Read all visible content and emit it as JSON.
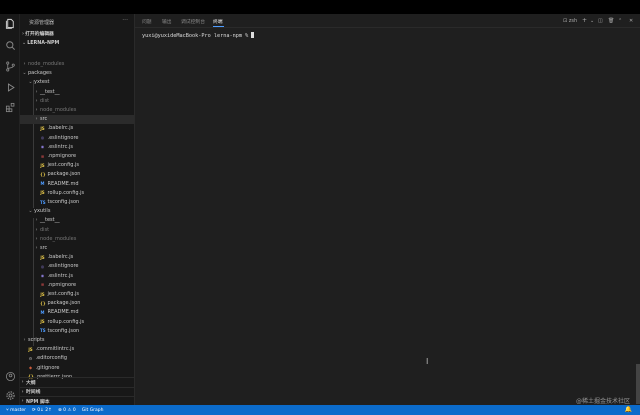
{
  "sidebar": {
    "title": "资源管理器",
    "open_editors": "打开的编辑器",
    "project": "LERNA-NPM",
    "rows": [
      {
        "label": "node_modules",
        "depth": 1,
        "chev": "›",
        "icon": "",
        "dim": true
      },
      {
        "label": "packages",
        "depth": 1,
        "chev": "⌄",
        "icon": "",
        "dim": false
      },
      {
        "label": "yxtest",
        "depth": 2,
        "chev": "⌄",
        "icon": "",
        "dim": false
      },
      {
        "label": "__test__",
        "depth": 3,
        "chev": "›",
        "icon": "",
        "dim": false
      },
      {
        "label": "dist",
        "depth": 3,
        "chev": "›",
        "icon": "",
        "dim": true
      },
      {
        "label": "node_modules",
        "depth": 3,
        "chev": "›",
        "icon": "",
        "dim": true
      },
      {
        "label": "src",
        "depth": 3,
        "chev": "›",
        "icon": "",
        "dim": false,
        "selected": true
      },
      {
        "label": ".babelrc.js",
        "depth": 3,
        "chev": "",
        "icon": "JS",
        "color": "#e8c94a"
      },
      {
        "label": ".eslintignore",
        "depth": 3,
        "chev": "",
        "icon": "◎",
        "color": "#8a7bd6"
      },
      {
        "label": ".eslintrc.js",
        "depth": 3,
        "chev": "",
        "icon": "◉",
        "color": "#8a7bd6"
      },
      {
        "label": ".npmignore",
        "depth": 3,
        "chev": "",
        "icon": "≡",
        "color": "#cc4b4b"
      },
      {
        "label": "jest.config.js",
        "depth": 3,
        "chev": "",
        "icon": "JS",
        "color": "#e8c94a"
      },
      {
        "label": "package.json",
        "depth": 3,
        "chev": "",
        "icon": "{}",
        "color": "#e8c94a"
      },
      {
        "label": "README.md",
        "depth": 3,
        "chev": "",
        "icon": "M",
        "color": "#4e9cff"
      },
      {
        "label": "rollup.config.js",
        "depth": 3,
        "chev": "",
        "icon": "JS",
        "color": "#e8c94a"
      },
      {
        "label": "tsconfig.json",
        "depth": 3,
        "chev": "",
        "icon": "TS",
        "color": "#4e9cff"
      },
      {
        "label": "yxutils",
        "depth": 2,
        "chev": "⌄",
        "icon": "",
        "dim": false
      },
      {
        "label": "__test__",
        "depth": 3,
        "chev": "›",
        "icon": "",
        "dim": false
      },
      {
        "label": "dist",
        "depth": 3,
        "chev": "›",
        "icon": "",
        "dim": true
      },
      {
        "label": "node_modules",
        "depth": 3,
        "chev": "›",
        "icon": "",
        "dim": true
      },
      {
        "label": "src",
        "depth": 3,
        "chev": "›",
        "icon": "",
        "dim": false
      },
      {
        "label": ".babelrc.js",
        "depth": 3,
        "chev": "",
        "icon": "JS",
        "color": "#e8c94a"
      },
      {
        "label": ".eslintignore",
        "depth": 3,
        "chev": "",
        "icon": "◎",
        "color": "#8a7bd6"
      },
      {
        "label": ".eslintrc.js",
        "depth": 3,
        "chev": "",
        "icon": "◉",
        "color": "#8a7bd6"
      },
      {
        "label": ".npmignore",
        "depth": 3,
        "chev": "",
        "icon": "≡",
        "color": "#cc4b4b"
      },
      {
        "label": "jest.config.js",
        "depth": 3,
        "chev": "",
        "icon": "JS",
        "color": "#e8c94a"
      },
      {
        "label": "package.json",
        "depth": 3,
        "chev": "",
        "icon": "{}",
        "color": "#e8c94a"
      },
      {
        "label": "README.md",
        "depth": 3,
        "chev": "",
        "icon": "M",
        "color": "#4e9cff"
      },
      {
        "label": "rollup.config.js",
        "depth": 3,
        "chev": "",
        "icon": "JS",
        "color": "#e8c94a"
      },
      {
        "label": "tsconfig.json",
        "depth": 3,
        "chev": "",
        "icon": "TS",
        "color": "#4e9cff"
      },
      {
        "label": "scripts",
        "depth": 1,
        "chev": "›",
        "icon": "",
        "dim": false
      },
      {
        "label": ".commitlintrc.js",
        "depth": 1,
        "chev": "",
        "icon": "JS",
        "color": "#e8c94a"
      },
      {
        "label": ".editorconfig",
        "depth": 1,
        "chev": "",
        "icon": "⚙",
        "color": "#aaaaaa"
      },
      {
        "label": ".gitignore",
        "depth": 1,
        "chev": "",
        "icon": "◆",
        "color": "#cc5b3b"
      },
      {
        "label": ".prettierrc.json",
        "depth": 1,
        "chev": "",
        "icon": "{}",
        "color": "#e8c94a"
      }
    ],
    "bottom_sections": [
      "大纲",
      "时间线",
      "NPM 脚本"
    ]
  },
  "panel": {
    "tabs": [
      "问题",
      "输出",
      "调试控制台",
      "终端"
    ],
    "active_tab": 3,
    "shell": "zsh",
    "prompt": "yuxi@yuxideMacBook-Pro lerna-npm %"
  },
  "watermark": "@稀土掘金技术社区",
  "status": {
    "branch": "master",
    "sync": "0↓ 2↑",
    "problems": "⊗ 0 ⚠ 0",
    "git_graph": "Git Graph"
  },
  "colors": {
    "statusbar": "#0b6bcb",
    "accent": "#4e9cff"
  }
}
